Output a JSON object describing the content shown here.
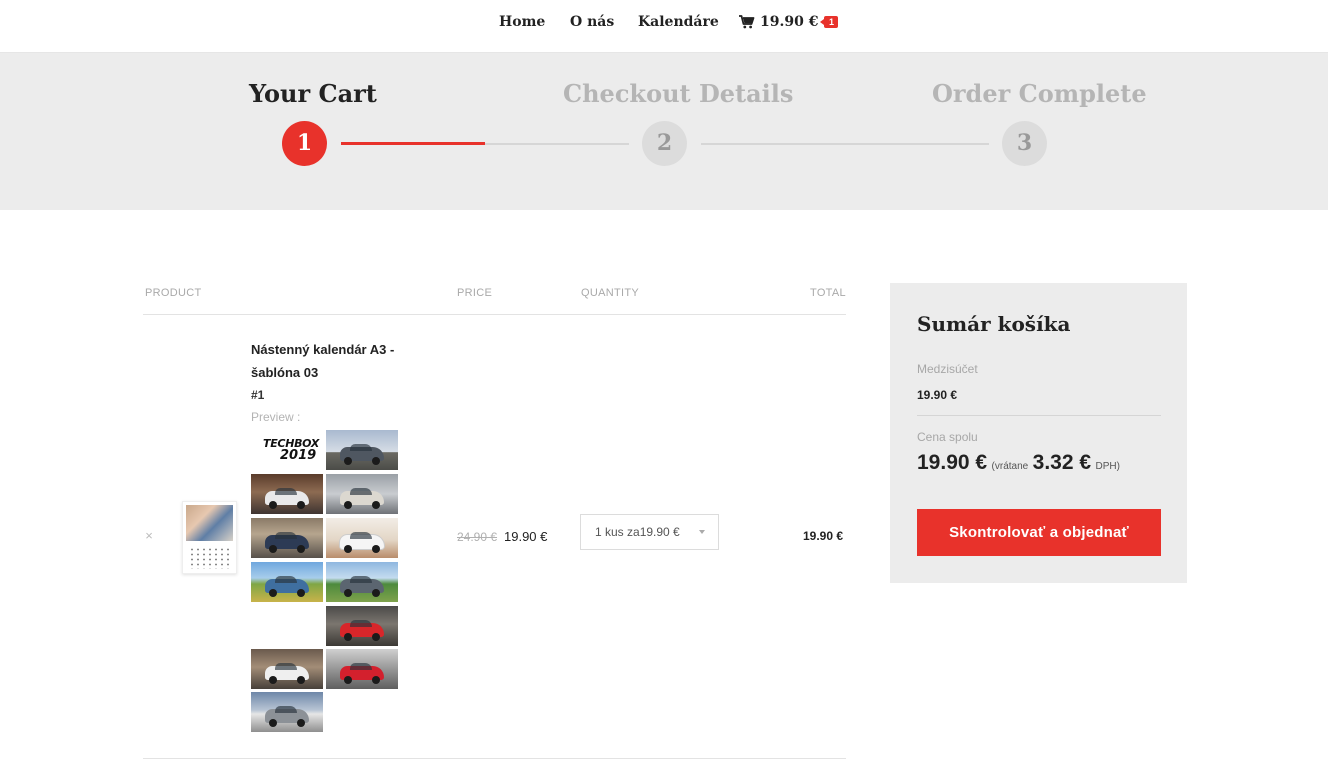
{
  "nav": {
    "home": "Home",
    "about": "O nás",
    "calendars": "Kalendáre",
    "cart_total": "19.90 €",
    "cart_count": "1"
  },
  "steps": [
    {
      "number": "1",
      "title": "Your Cart",
      "state": "active"
    },
    {
      "number": "2",
      "title": "Checkout Details",
      "state": "inactive"
    },
    {
      "number": "3",
      "title": "Order Complete",
      "state": "inactive"
    }
  ],
  "cart_table": {
    "headers": {
      "product": "PRODUCT",
      "price": "PRICE",
      "quantity": "QUANTITY",
      "total": "TOTAL"
    },
    "item": {
      "name_line1": "Nástenný kalendár A3 -",
      "name_line2": "šablóna 03",
      "variant": "#1",
      "preview_label": "Preview :",
      "preview_logo_top": "TECHBOX",
      "preview_logo_bottom": "2019",
      "remove_symbol": "×",
      "price_old": "24.90 €",
      "price_new": "19.90 €",
      "quantity_selected": "1 kus za19.90 €",
      "total": "19.90 €"
    }
  },
  "summary": {
    "title": "Sumár košíka",
    "subtotal_label": "Medzisúčet",
    "subtotal_value": "19.90 €",
    "total_label": "Cena spolu",
    "total_value": "19.90 €",
    "vat_prefix": "(vrátane",
    "vat_value": "3.32 €",
    "vat_suffix": "DPH)",
    "checkout_button": "Skontrolovať a objednať"
  },
  "colors": {
    "accent": "#e8322b",
    "band_bg": "#ececec",
    "muted_text": "#b5b5b5"
  },
  "icons": {
    "cart": "shopping-cart-icon",
    "remove": "close-icon",
    "dropdown": "chevron-down-icon"
  }
}
